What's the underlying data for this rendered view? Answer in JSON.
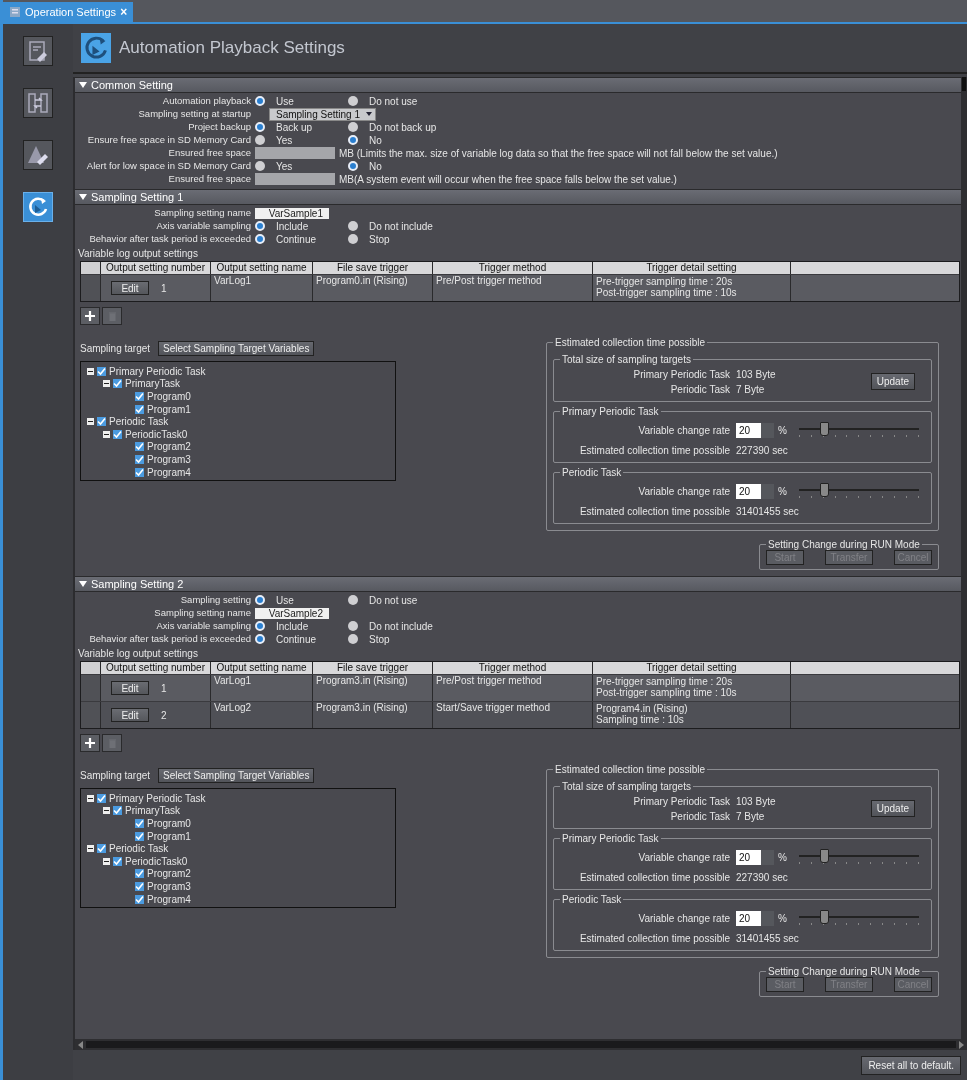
{
  "tab": {
    "label": "Operation Settings",
    "close": "×",
    "selected": true
  },
  "sidebar": {
    "items": [
      {
        "selected": false
      },
      {
        "selected": false
      },
      {
        "selected": false
      },
      {
        "selected": true
      }
    ]
  },
  "page_title": "Automation Playback Settings",
  "common_setting": {
    "title": "Common Setting",
    "expanded": true,
    "rows": [
      {
        "kind": "radio",
        "label": "Automation playback",
        "options": [
          {
            "label": "Use",
            "selected": true
          },
          {
            "label": "Do not use",
            "selected": false
          }
        ]
      },
      {
        "kind": "dropdown",
        "label": "Sampling setting at startup",
        "value": "Sampling Setting 1"
      },
      {
        "kind": "radio",
        "label": "Project backup",
        "options": [
          {
            "label": "Back up",
            "selected": true
          },
          {
            "label": "Do not back up",
            "selected": false
          }
        ]
      },
      {
        "kind": "radio",
        "label": "Ensure free space in SD Memory Card",
        "options": [
          {
            "label": "Yes",
            "selected": false
          },
          {
            "label": "No",
            "selected": true
          }
        ]
      },
      {
        "kind": "input",
        "label": "Ensured free space",
        "note": "MB  (Limits the max. size of variable log data so that the free space will not fall below the set value.)"
      },
      {
        "kind": "radio",
        "label": "Alert for low space in SD Memory Card",
        "options": [
          {
            "label": "Yes",
            "selected": false
          },
          {
            "label": "No",
            "selected": true
          }
        ]
      },
      {
        "kind": "input",
        "label": "Ensured free space",
        "note": "MB(A system event will occur when the free space falls below the set value.)"
      }
    ]
  },
  "sampling_settings": [
    {
      "title": "Sampling Setting 1",
      "expanded": true,
      "rows": [
        {
          "kind": "text",
          "label": "Sampling setting name",
          "value": "VarSample1"
        },
        {
          "kind": "radio",
          "label": "Axis variable sampling",
          "options": [
            {
              "label": "Include",
              "selected": true
            },
            {
              "label": "Do not include",
              "selected": false
            }
          ]
        },
        {
          "kind": "radio",
          "label": "Behavior after task period is exceeded",
          "options": [
            {
              "label": "Continue",
              "selected": true
            },
            {
              "label": "Stop",
              "selected": false
            }
          ]
        }
      ],
      "log_title": "Variable log output settings",
      "columns": [
        "Output setting number",
        "Output setting name",
        "File save trigger",
        "Trigger method",
        "Trigger detail setting"
      ],
      "log_rows": [
        {
          "edit": "Edit",
          "number": "1",
          "name": "VarLog1",
          "trigger": "Program0.in (Rising)",
          "method": "Pre/Post trigger method",
          "detail": [
            "Pre-trigger sampling time : 20s",
            "Post-trigger sampling time : 10s"
          ]
        }
      ],
      "target_label": "Sampling target",
      "select_button": "Select Sampling Target Variables",
      "tree": [
        {
          "label": "Primary Periodic Task",
          "checked": true,
          "expanded": true,
          "children": [
            {
              "label": "PrimaryTask",
              "checked": true,
              "expanded": true,
              "children": [
                {
                  "label": "Program0",
                  "checked": true
                },
                {
                  "label": "Program1",
                  "checked": true
                }
              ]
            }
          ]
        },
        {
          "label": "Periodic Task",
          "checked": true,
          "expanded": true,
          "children": [
            {
              "label": "PeriodicTask0",
              "checked": true,
              "expanded": true,
              "children": [
                {
                  "label": "Program2",
                  "checked": true
                },
                {
                  "label": "Program3",
                  "checked": true
                },
                {
                  "label": "Program4",
                  "checked": true
                }
              ]
            }
          ]
        }
      ],
      "estimate": {
        "title": "Estimated collection time possible",
        "total": {
          "title": "Total size of sampling targets",
          "items": [
            {
              "label": "Primary Periodic Task",
              "value": "103 Byte"
            },
            {
              "label": "Periodic Task",
              "value": "7 Byte"
            }
          ],
          "update_button": "Update"
        },
        "tasks": [
          {
            "title": "Primary Periodic Task",
            "rate_label": "Variable change rate",
            "rate": "20",
            "unit": "%",
            "level": 0.2,
            "estimate_label": "Estimated collection time possible",
            "estimate_value": "227390 sec"
          },
          {
            "title": "Periodic Task",
            "rate_label": "Variable change rate",
            "rate": "20",
            "unit": "%",
            "level": 0.2,
            "estimate_label": "Estimated collection time possible",
            "estimate_value": "31401455 sec"
          }
        ]
      },
      "run_mode": {
        "title": "Setting Change during RUN Mode",
        "buttons": [
          {
            "label": "Start",
            "disabled": true
          },
          {
            "label": "Transfer",
            "disabled": true
          },
          {
            "label": "Cancel",
            "disabled": true
          }
        ]
      }
    },
    {
      "title": "Sampling Setting 2",
      "expanded": true,
      "rows": [
        {
          "kind": "radio",
          "label": "Sampling setting",
          "options": [
            {
              "label": "Use",
              "selected": true
            },
            {
              "label": "Do not use",
              "selected": false
            }
          ]
        },
        {
          "kind": "text",
          "label": "Sampling setting name",
          "value": "VarSample2"
        },
        {
          "kind": "radio",
          "label": "Axis variable sampling",
          "options": [
            {
              "label": "Include",
              "selected": true
            },
            {
              "label": "Do not include",
              "selected": false
            }
          ]
        },
        {
          "kind": "radio",
          "label": "Behavior after task period is exceeded",
          "options": [
            {
              "label": "Continue",
              "selected": true
            },
            {
              "label": "Stop",
              "selected": false
            }
          ]
        }
      ],
      "log_title": "Variable log output settings",
      "columns": [
        "Output setting number",
        "Output setting name",
        "File save trigger",
        "Trigger method",
        "Trigger detail setting"
      ],
      "log_rows": [
        {
          "edit": "Edit",
          "number": "1",
          "name": "VarLog1",
          "trigger": "Program3.in (Rising)",
          "method": "Pre/Post trigger method",
          "detail": [
            "Pre-trigger sampling time : 20s",
            "Post-trigger sampling time : 10s"
          ]
        },
        {
          "edit": "Edit",
          "number": "2",
          "name": "VarLog2",
          "trigger": "Program3.in (Rising)",
          "method": "Start/Save trigger method",
          "detail": [
            "Program4.in (Rising)",
            "Sampling time : 10s"
          ]
        }
      ],
      "target_label": "Sampling target",
      "select_button": "Select Sampling Target Variables",
      "tree": [
        {
          "label": "Primary Periodic Task",
          "checked": true,
          "expanded": true,
          "children": [
            {
              "label": "PrimaryTask",
              "checked": true,
              "expanded": true,
              "children": [
                {
                  "label": "Program0",
                  "checked": true
                },
                {
                  "label": "Program1",
                  "checked": true
                }
              ]
            }
          ]
        },
        {
          "label": "Periodic Task",
          "checked": true,
          "expanded": true,
          "children": [
            {
              "label": "PeriodicTask0",
              "checked": true,
              "expanded": true,
              "children": [
                {
                  "label": "Program2",
                  "checked": true
                },
                {
                  "label": "Program3",
                  "checked": true
                },
                {
                  "label": "Program4",
                  "checked": true
                }
              ]
            }
          ]
        }
      ],
      "estimate": {
        "title": "Estimated collection time possible",
        "total": {
          "title": "Total size of sampling targets",
          "items": [
            {
              "label": "Primary Periodic Task",
              "value": "103 Byte"
            },
            {
              "label": "Periodic Task",
              "value": "7 Byte"
            }
          ],
          "update_button": "Update"
        },
        "tasks": [
          {
            "title": "Primary Periodic Task",
            "rate_label": "Variable change rate",
            "rate": "20",
            "unit": "%",
            "level": 0.2,
            "estimate_label": "Estimated collection time possible",
            "estimate_value": "227390 sec"
          },
          {
            "title": "Periodic Task",
            "rate_label": "Variable change rate",
            "rate": "20",
            "unit": "%",
            "level": 0.2,
            "estimate_label": "Estimated collection time possible",
            "estimate_value": "31401455 sec"
          }
        ]
      },
      "run_mode": {
        "title": "Setting Change during RUN Mode",
        "buttons": [
          {
            "label": "Start",
            "disabled": true
          },
          {
            "label": "Transfer",
            "disabled": true
          },
          {
            "label": "Cancel",
            "disabled": true
          }
        ]
      }
    }
  ],
  "reset_button": "Reset all to default."
}
